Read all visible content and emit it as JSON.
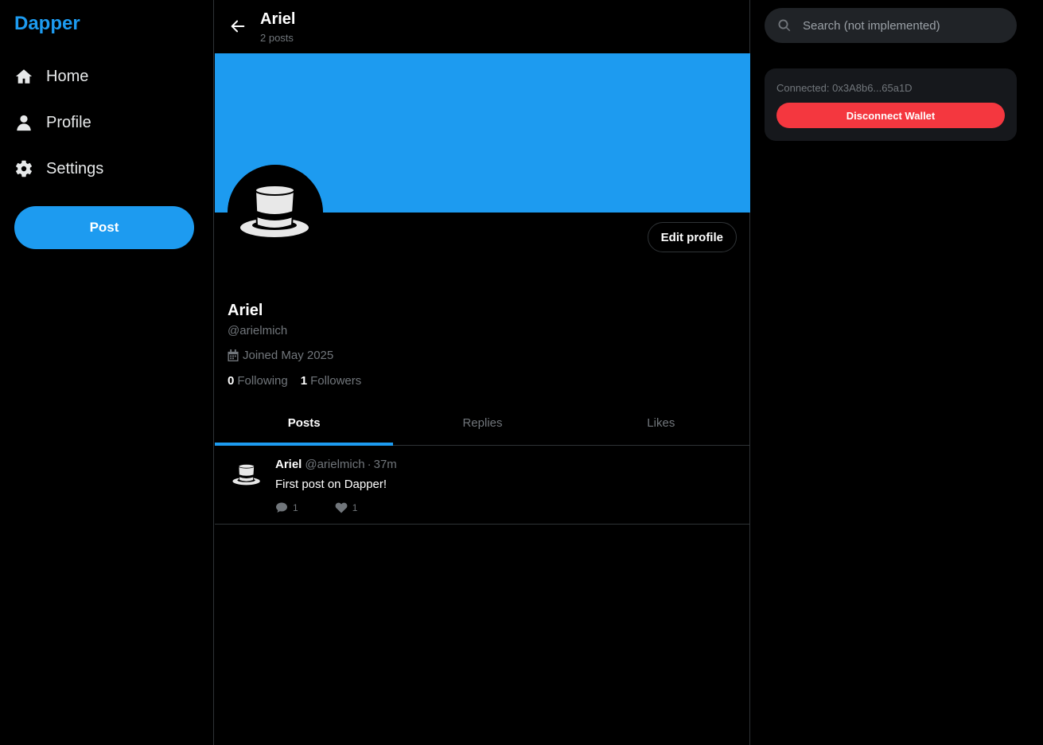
{
  "app": {
    "brand": "Dapper"
  },
  "nav": {
    "items": [
      {
        "label": "Home",
        "icon": "home-icon"
      },
      {
        "label": "Profile",
        "icon": "user-icon"
      },
      {
        "label": "Settings",
        "icon": "gear-icon"
      }
    ],
    "post_label": "Post"
  },
  "header": {
    "name": "Ariel",
    "post_count": "2 posts"
  },
  "profile": {
    "banner_color": "#1d9bf0",
    "edit_label": "Edit profile",
    "name": "Ariel",
    "handle": "@arielmich",
    "joined": "Joined May 2025",
    "following_count": "0",
    "following_label": "Following",
    "followers_count": "1",
    "followers_label": "Followers"
  },
  "tabs": [
    {
      "label": "Posts",
      "active": true
    },
    {
      "label": "Replies",
      "active": false
    },
    {
      "label": "Likes",
      "active": false
    }
  ],
  "posts": [
    {
      "name": "Ariel",
      "handle": "@arielmich",
      "separator": "·",
      "time": "37m",
      "text": "First post on Dapper!",
      "replies": "1",
      "likes": "1"
    }
  ],
  "search": {
    "placeholder": "Search (not implemented)"
  },
  "wallet": {
    "status": "Connected: 0x3A8b6...65a1D",
    "disconnect_label": "Disconnect Wallet",
    "disconnect_color": "#f4373f"
  },
  "colors": {
    "accent": "#1d9bf0",
    "background": "#000000",
    "muted": "#71767b"
  }
}
